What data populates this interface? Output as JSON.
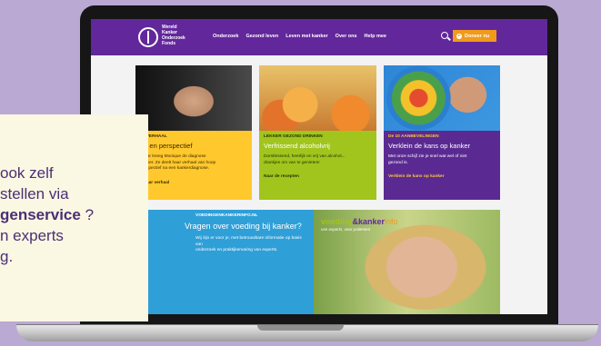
{
  "header": {
    "logo_lines": [
      "Wereld",
      "Kanker",
      "Onderzoek",
      "Fonds"
    ],
    "nav": [
      "Onderzoek",
      "Gezond leven",
      "Leven met kanker",
      "Over ons",
      "Help mee"
    ],
    "donate_label": "Doneer nu"
  },
  "cards": [
    {
      "category": "ERVERHAAL",
      "title": "op en perspectief",
      "desc_lines": [
        "g jaar kreeg Monique de diagnose",
        "kanker. Ze deelt haar verhaal van hoop",
        "perspectief na een kankerdiagnose."
      ],
      "link": "s haar verhaal"
    },
    {
      "category": "LEKKER GEZOND DRINKEN",
      "title": "Verfrissend alcoholvrij",
      "desc_lines": [
        "Dorstlessend, heerlijk en vrij van alcohol...",
        "drankjes om van te genieten!"
      ],
      "link": "Naar de recepten"
    },
    {
      "category": "De 10 AANBEVELINGEN",
      "title": "Verklein de kans op kanker",
      "desc_lines": [
        "Met onze schijf zie je snel wat wel of niet",
        "gezond is."
      ],
      "link": "Verklein de kans op kanker"
    }
  ],
  "banner_blue": {
    "category": "VOEDINGENKANKERINFO.NL",
    "title": "Vragen over voeding bij kanker?",
    "desc_lines": [
      "Wij zijn er voor je, met betrouwbare informatie op basis van",
      "onderzoek en praktijkervaring van experts."
    ]
  },
  "banner_logo": {
    "word1": "voeding",
    "amp": "&",
    "word2": "kanker",
    "word3": "info",
    "tagline": "van experts, voor patiënten"
  },
  "callout": {
    "line1": "ook zelf",
    "line2": "stellen via",
    "line3_bold": "genservice",
    "line3_rest": " ?",
    "line4": "n experts",
    "line5": "g."
  },
  "colors": {
    "brand_purple": "#62279b",
    "yellow": "#ffc82c",
    "green": "#a1c51d",
    "orange": "#f29a1a",
    "blue": "#2f9fd8",
    "background_lilac": "#b9a9d3"
  }
}
